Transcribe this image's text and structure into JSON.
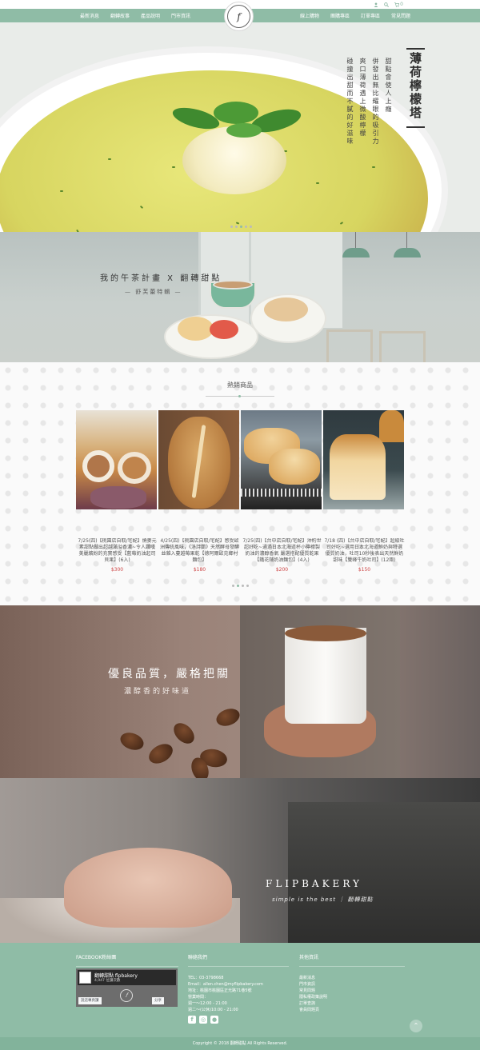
{
  "topbar": {
    "cart_count": "0"
  },
  "nav": {
    "left": [
      "最新消息",
      "翻轉故事",
      "產品說明",
      "門市資訊"
    ],
    "right": [
      "線上購物",
      "團購專區",
      "訂單專區",
      "常見問題"
    ],
    "logo": "𝑓"
  },
  "hero": {
    "title": "薄荷檸檬塔",
    "lines": [
      "甜點會使人上癮",
      "併發出無比耀眼的吸引力",
      "爽口薄荷遇上微酸檸檬",
      "碰撞出甜而不膩的好滋味"
    ],
    "dots": 5,
    "active_dot": 2
  },
  "tea": {
    "title": "我的午茶計畫 X 翻轉甜點",
    "subtitle": "— 舒芙蕾特輯 —"
  },
  "products": {
    "heading": "熱銷商品",
    "items": [
      {
        "desc": "7/25(四)【桃園店自取/宅配】燒麥元素甜點做出超越滿溢香濃~令人讚嘆美麗繽紛的充實感受【藍莓奶油起司貝果】(6入)",
        "price": "$300"
      },
      {
        "desc": "4/25(四)【桃園店自取/宅配】感受歐洲傳統風味，《洛詩蘭》天然酵母發酵並雜入蔓越莓果乾【德阿爾歐克鄉村麵包】",
        "price": "$180"
      },
      {
        "desc": "7/25(四)【台中店自取/宅配】沖約世超好吃~通過日本北海道杯小檸檬製奶油的濃醇香氣 嚴選搭配優質乾果【鐵花鋪奶油麵包】(4入)",
        "price": "$200"
      },
      {
        "desc": "7/18 (四)【台中店自取/宅配】超級吐司好吃~選用日本北海道鮮奶與特選優質奶油，吐司10秒後表出天然鮮奶甜味【雙峰牛奶吐司】(12兩)",
        "price": "$150"
      }
    ],
    "dots": 4,
    "active_dot": 1
  },
  "coffee": {
    "title": "優良品質，嚴格把關",
    "subtitle": "濃醇香的好味道"
  },
  "flip": {
    "title": "FLIPBAKERY",
    "tagline": "simple is the best ｜ 翻轉甜點"
  },
  "footer": {
    "fb_heading": "FACEBOOK粉絲團",
    "fb_name": "翻轉甜點 flpbakery",
    "fb_likes": "4,947 位讚次數",
    "fb_like_btn": "說這專頁讚",
    "fb_share_btn": "分享",
    "contact_heading": "聯絡我們",
    "contact_lines": [
      "TEL：03-3798668",
      "Email：allen.chen@myflipbakery.com",
      "地址：桃園市桃園區正光路71巷5號",
      "營業時間：",
      "週一～12:00 - 21:00",
      "週二～(公休)10:00 - 21:00"
    ],
    "links_heading": "其他資訊",
    "links": [
      "最新消息",
      "門市資訊",
      "常見問題",
      "隱私權政策說明",
      "訂單查詢",
      "會員問題頁"
    ],
    "copyright": "Copyright © 2018 翻轉甜點 All Rights Reserved."
  },
  "colors": {
    "brand": "#8fbca6",
    "price": "#c44444"
  }
}
